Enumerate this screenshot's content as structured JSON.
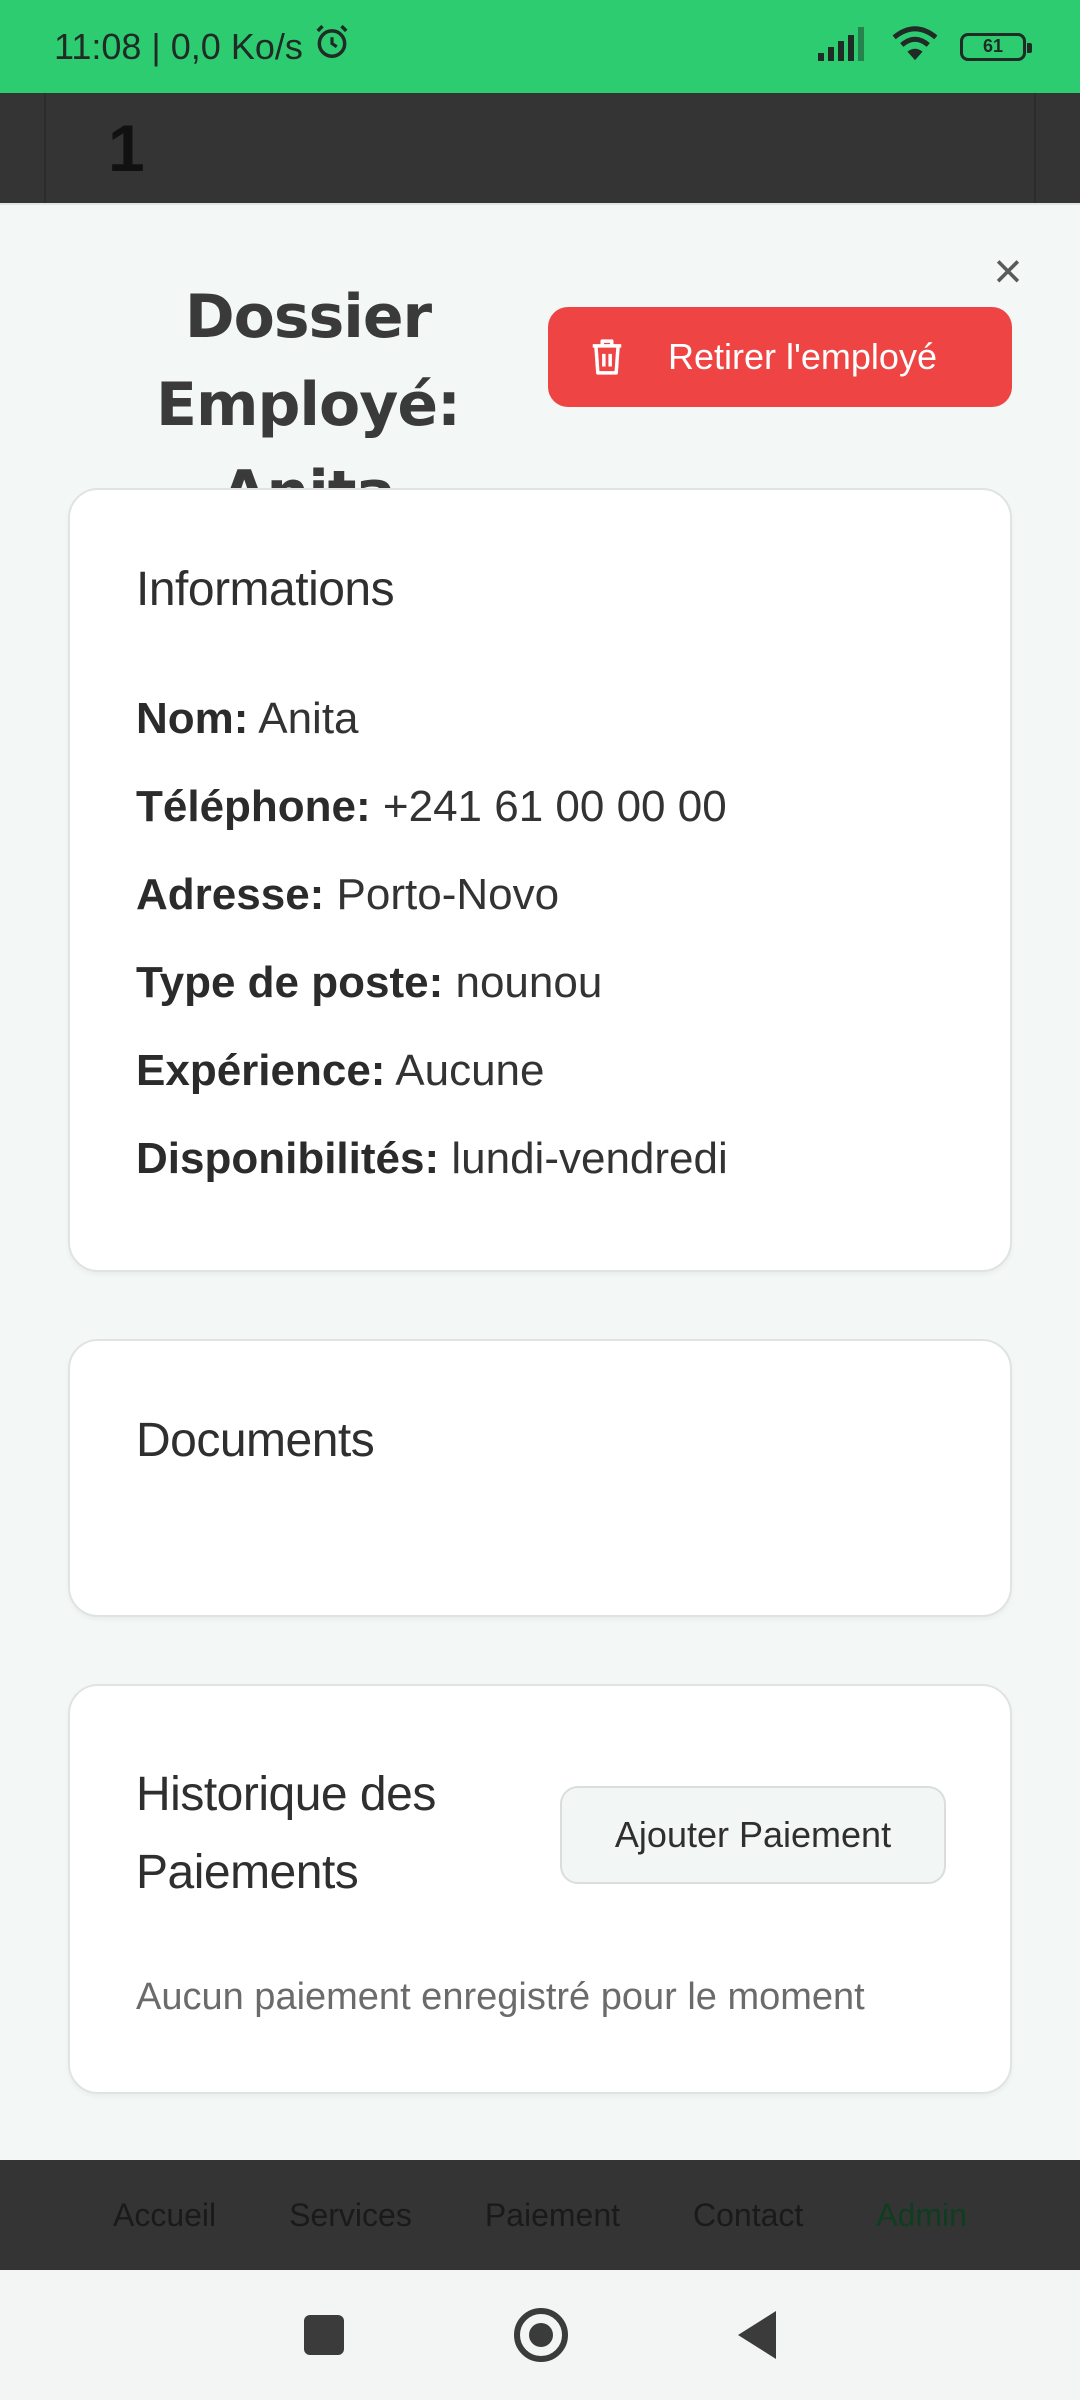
{
  "status_bar": {
    "time": "11:08",
    "speed": "0,0 Ko/s",
    "battery": "61"
  },
  "background": {
    "number": "1",
    "nav": [
      "Accueil",
      "Services",
      "Paiement",
      "Contact",
      "Admin"
    ]
  },
  "modal": {
    "close_label": "×",
    "title": "Dossier Employé: Anita",
    "remove_label": "Retirer l'employé",
    "info": {
      "title": "Informations",
      "rows": [
        {
          "label": "Nom:",
          "value": "Anita"
        },
        {
          "label": "Téléphone:",
          "value": "+241 61 00 00 00"
        },
        {
          "label": "Adresse:",
          "value": "Porto-Novo"
        },
        {
          "label": "Type de poste:",
          "value": "nounou"
        },
        {
          "label": "Expérience:",
          "value": "Aucune"
        },
        {
          "label": "Disponibilités:",
          "value": "lundi-vendredi"
        }
      ]
    },
    "documents": {
      "title": "Documents"
    },
    "payments": {
      "title": "Historique des Paiements",
      "add_label": "Ajouter Paiement",
      "empty": "Aucun paiement enregistré pour le moment"
    }
  },
  "colors": {
    "status_bar": "#2ecc71",
    "danger": "#ef4444",
    "active_nav": "#0f3d1f"
  }
}
